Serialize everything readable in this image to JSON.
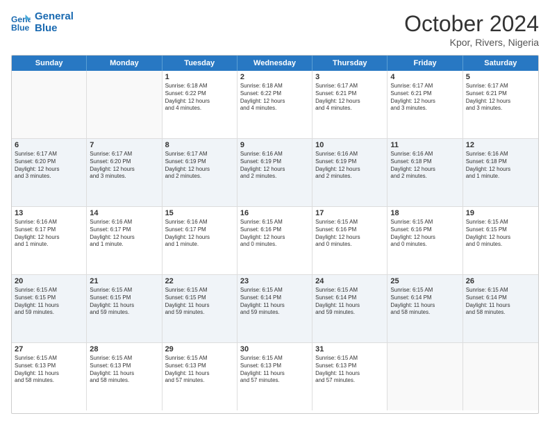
{
  "logo": {
    "line1": "General",
    "line2": "Blue"
  },
  "title": "October 2024",
  "subtitle": "Kpor, Rivers, Nigeria",
  "header_days": [
    "Sunday",
    "Monday",
    "Tuesday",
    "Wednesday",
    "Thursday",
    "Friday",
    "Saturday"
  ],
  "weeks": [
    [
      {
        "day": "",
        "info": ""
      },
      {
        "day": "",
        "info": ""
      },
      {
        "day": "1",
        "info": "Sunrise: 6:18 AM\nSunset: 6:22 PM\nDaylight: 12 hours\nand 4 minutes."
      },
      {
        "day": "2",
        "info": "Sunrise: 6:18 AM\nSunset: 6:22 PM\nDaylight: 12 hours\nand 4 minutes."
      },
      {
        "day": "3",
        "info": "Sunrise: 6:17 AM\nSunset: 6:21 PM\nDaylight: 12 hours\nand 4 minutes."
      },
      {
        "day": "4",
        "info": "Sunrise: 6:17 AM\nSunset: 6:21 PM\nDaylight: 12 hours\nand 3 minutes."
      },
      {
        "day": "5",
        "info": "Sunrise: 6:17 AM\nSunset: 6:21 PM\nDaylight: 12 hours\nand 3 minutes."
      }
    ],
    [
      {
        "day": "6",
        "info": "Sunrise: 6:17 AM\nSunset: 6:20 PM\nDaylight: 12 hours\nand 3 minutes."
      },
      {
        "day": "7",
        "info": "Sunrise: 6:17 AM\nSunset: 6:20 PM\nDaylight: 12 hours\nand 3 minutes."
      },
      {
        "day": "8",
        "info": "Sunrise: 6:17 AM\nSunset: 6:19 PM\nDaylight: 12 hours\nand 2 minutes."
      },
      {
        "day": "9",
        "info": "Sunrise: 6:16 AM\nSunset: 6:19 PM\nDaylight: 12 hours\nand 2 minutes."
      },
      {
        "day": "10",
        "info": "Sunrise: 6:16 AM\nSunset: 6:19 PM\nDaylight: 12 hours\nand 2 minutes."
      },
      {
        "day": "11",
        "info": "Sunrise: 6:16 AM\nSunset: 6:18 PM\nDaylight: 12 hours\nand 2 minutes."
      },
      {
        "day": "12",
        "info": "Sunrise: 6:16 AM\nSunset: 6:18 PM\nDaylight: 12 hours\nand 1 minute."
      }
    ],
    [
      {
        "day": "13",
        "info": "Sunrise: 6:16 AM\nSunset: 6:17 PM\nDaylight: 12 hours\nand 1 minute."
      },
      {
        "day": "14",
        "info": "Sunrise: 6:16 AM\nSunset: 6:17 PM\nDaylight: 12 hours\nand 1 minute."
      },
      {
        "day": "15",
        "info": "Sunrise: 6:16 AM\nSunset: 6:17 PM\nDaylight: 12 hours\nand 1 minute."
      },
      {
        "day": "16",
        "info": "Sunrise: 6:15 AM\nSunset: 6:16 PM\nDaylight: 12 hours\nand 0 minutes."
      },
      {
        "day": "17",
        "info": "Sunrise: 6:15 AM\nSunset: 6:16 PM\nDaylight: 12 hours\nand 0 minutes."
      },
      {
        "day": "18",
        "info": "Sunrise: 6:15 AM\nSunset: 6:16 PM\nDaylight: 12 hours\nand 0 minutes."
      },
      {
        "day": "19",
        "info": "Sunrise: 6:15 AM\nSunset: 6:15 PM\nDaylight: 12 hours\nand 0 minutes."
      }
    ],
    [
      {
        "day": "20",
        "info": "Sunrise: 6:15 AM\nSunset: 6:15 PM\nDaylight: 11 hours\nand 59 minutes."
      },
      {
        "day": "21",
        "info": "Sunrise: 6:15 AM\nSunset: 6:15 PM\nDaylight: 11 hours\nand 59 minutes."
      },
      {
        "day": "22",
        "info": "Sunrise: 6:15 AM\nSunset: 6:15 PM\nDaylight: 11 hours\nand 59 minutes."
      },
      {
        "day": "23",
        "info": "Sunrise: 6:15 AM\nSunset: 6:14 PM\nDaylight: 11 hours\nand 59 minutes."
      },
      {
        "day": "24",
        "info": "Sunrise: 6:15 AM\nSunset: 6:14 PM\nDaylight: 11 hours\nand 59 minutes."
      },
      {
        "day": "25",
        "info": "Sunrise: 6:15 AM\nSunset: 6:14 PM\nDaylight: 11 hours\nand 58 minutes."
      },
      {
        "day": "26",
        "info": "Sunrise: 6:15 AM\nSunset: 6:14 PM\nDaylight: 11 hours\nand 58 minutes."
      }
    ],
    [
      {
        "day": "27",
        "info": "Sunrise: 6:15 AM\nSunset: 6:13 PM\nDaylight: 11 hours\nand 58 minutes."
      },
      {
        "day": "28",
        "info": "Sunrise: 6:15 AM\nSunset: 6:13 PM\nDaylight: 11 hours\nand 58 minutes."
      },
      {
        "day": "29",
        "info": "Sunrise: 6:15 AM\nSunset: 6:13 PM\nDaylight: 11 hours\nand 57 minutes."
      },
      {
        "day": "30",
        "info": "Sunrise: 6:15 AM\nSunset: 6:13 PM\nDaylight: 11 hours\nand 57 minutes."
      },
      {
        "day": "31",
        "info": "Sunrise: 6:15 AM\nSunset: 6:13 PM\nDaylight: 11 hours\nand 57 minutes."
      },
      {
        "day": "",
        "info": ""
      },
      {
        "day": "",
        "info": ""
      }
    ]
  ]
}
